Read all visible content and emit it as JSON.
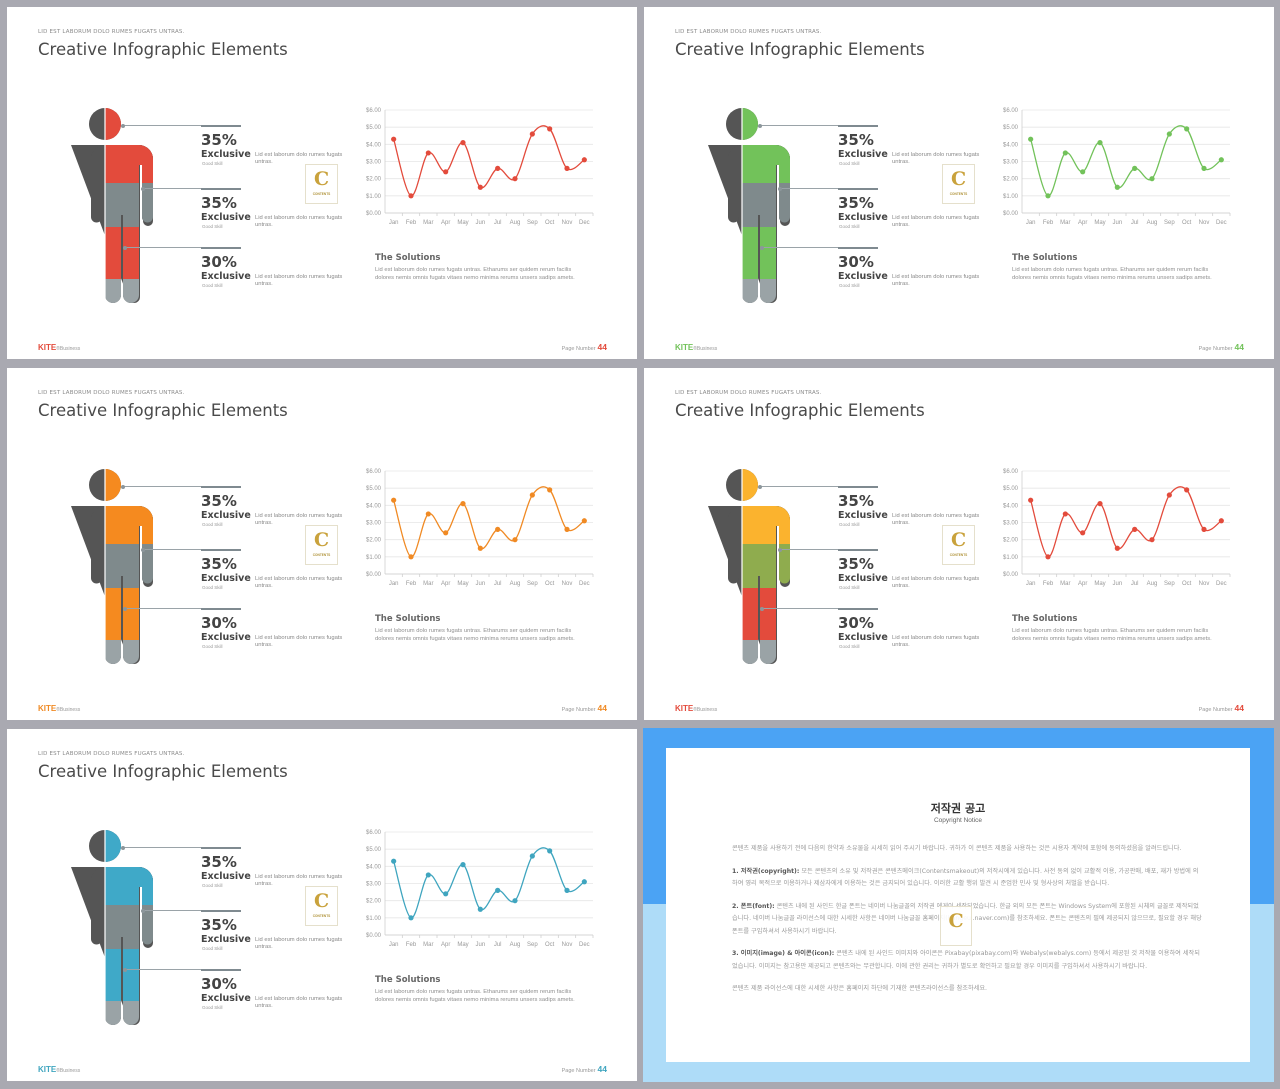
{
  "slides": [
    {
      "subtitle": "LID EST LABORUM DOLO RUMES FUGATS UNTRAS.",
      "title": "Creative Infographic Elements",
      "theme": {
        "accent": "#e34b3c",
        "upper": "#e34b3c",
        "mid": "#7f8a8c",
        "lower": "#e34b3c",
        "foot": "#9aa3a6"
      },
      "stats": [
        {
          "percent": "35%",
          "label": "Exclusive",
          "sub": "Good Skill",
          "desc": "Lid est laborum dolo rumes fugats untras."
        },
        {
          "percent": "35%",
          "label": "Exclusive",
          "sub": "Good Skill",
          "desc": "Lid est laborum dolo rumes fugats untras."
        },
        {
          "percent": "30%",
          "label": "Exclusive",
          "sub": "Good Skill",
          "desc": "Lid est laborum dolo rumes fugats untras."
        }
      ],
      "solutions_title": "The Solutions",
      "solutions_text": "Lid est laborum dolo rumes fugats untras. Etharums ser quidem rerum facilis dolores nemis omnis fugats vitaes nemo minima rerums unsers sadips amets.",
      "brand": "KITE",
      "brand_suffix": "®Business",
      "page_label": "Page Number",
      "page_number": "44"
    },
    {
      "subtitle": "LID EST LABORUM DOLO RUMES FUGATS UNTRAS.",
      "title": "Creative Infographic Elements",
      "theme": {
        "accent": "#72c25a",
        "upper": "#72c25a",
        "mid": "#7f8a8c",
        "lower": "#72c25a",
        "foot": "#9aa3a6"
      },
      "stats": [
        {
          "percent": "35%",
          "label": "Exclusive",
          "sub": "Good Skill",
          "desc": "Lid est laborum dolo rumes fugats untras."
        },
        {
          "percent": "35%",
          "label": "Exclusive",
          "sub": "Good Skill",
          "desc": "Lid est laborum dolo rumes fugats untras."
        },
        {
          "percent": "30%",
          "label": "Exclusive",
          "sub": "Good Skill",
          "desc": "Lid est laborum dolo rumes fugats untras."
        }
      ],
      "solutions_title": "The Solutions",
      "solutions_text": "Lid est laborum dolo rumes fugats untras. Etharums ser quidem rerum facilis dolores nemis omnis fugats vitaes nemo minima rerums unsers sadips amets.",
      "brand": "KITE",
      "brand_suffix": "®Business",
      "page_label": "Page Number",
      "page_number": "44"
    },
    {
      "subtitle": "LID EST LABORUM DOLO RUMES FUGATS UNTRAS.",
      "title": "Creative Infographic Elements",
      "theme": {
        "accent": "#f08a24",
        "upper": "#f58a1f",
        "mid": "#7f8a8c",
        "lower": "#f58a1f",
        "foot": "#9aa3a6"
      },
      "stats": [
        {
          "percent": "35%",
          "label": "Exclusive",
          "sub": "Good Skill",
          "desc": "Lid est laborum dolo rumes fugats untras."
        },
        {
          "percent": "35%",
          "label": "Exclusive",
          "sub": "Good Skill",
          "desc": "Lid est laborum dolo rumes fugats untras."
        },
        {
          "percent": "30%",
          "label": "Exclusive",
          "sub": "Good Skill",
          "desc": "Lid est laborum dolo rumes fugats untras."
        }
      ],
      "solutions_title": "The Solutions",
      "solutions_text": "Lid est laborum dolo rumes fugats untras. Etharums ser quidem rerum facilis dolores nemis omnis fugats vitaes nemo minima rerums unsers sadips amets.",
      "brand": "KITE",
      "brand_suffix": "®Business",
      "page_label": "Page Number",
      "page_number": "44"
    },
    {
      "subtitle": "LID EST LABORUM DOLO RUMES FUGATS UNTRAS.",
      "title": "Creative Infographic Elements",
      "theme": {
        "accent": "#e34b3c",
        "upper": "#fbb32e",
        "mid": "#8fac4e",
        "lower": "#e34b3c",
        "foot": "#9aa3a6"
      },
      "stats": [
        {
          "percent": "35%",
          "label": "Exclusive",
          "sub": "Good Skill",
          "desc": "Lid est laborum dolo rumes fugats untras."
        },
        {
          "percent": "35%",
          "label": "Exclusive",
          "sub": "Good Skill",
          "desc": "Lid est laborum dolo rumes fugats untras."
        },
        {
          "percent": "30%",
          "label": "Exclusive",
          "sub": "Good Skill",
          "desc": "Lid est laborum dolo rumes fugats untras."
        }
      ],
      "solutions_title": "The Solutions",
      "solutions_text": "Lid est laborum dolo rumes fugats untras. Etharums ser quidem rerum facilis dolores nemis omnis fugats vitaes nemo minima rerums unsers sadips amets.",
      "brand": "KITE",
      "brand_suffix": "®Business",
      "page_label": "Page Number",
      "page_number": "44"
    },
    {
      "subtitle": "LID EST LABORUM DOLO RUMES FUGATS UNTRAS.",
      "title": "Creative Infographic Elements",
      "theme": {
        "accent": "#3fa5bf",
        "upper": "#3fa9c8",
        "mid": "#7f8a8c",
        "lower": "#3fa9c8",
        "foot": "#9aa3a6"
      },
      "stats": [
        {
          "percent": "35%",
          "label": "Exclusive",
          "sub": "Good Skill",
          "desc": "Lid est laborum dolo rumes fugats untras."
        },
        {
          "percent": "35%",
          "label": "Exclusive",
          "sub": "Good Skill",
          "desc": "Lid est laborum dolo rumes fugats untras."
        },
        {
          "percent": "30%",
          "label": "Exclusive",
          "sub": "Good Skill",
          "desc": "Lid est laborum dolo rumes fugats untras."
        }
      ],
      "solutions_title": "The Solutions",
      "solutions_text": "Lid est laborum dolo rumes fugats untras. Etharums ser quidem rerum facilis dolores nemis omnis fugats vitaes nemo minima rerums unsers sadips amets.",
      "brand": "KITE",
      "brand_suffix": "®Business",
      "page_label": "Page Number",
      "page_number": "44"
    }
  ],
  "logo": {
    "letter": "C",
    "caption": "CONTENTS"
  },
  "colors": {
    "figure_dark": "#555555",
    "grid": "#e6e6e6",
    "axis": "#cfcfcf",
    "tick_text": "#999999"
  },
  "chart_data": {
    "type": "line",
    "smooth": true,
    "categories": [
      "Jan",
      "Feb",
      "Mar",
      "Apr",
      "May",
      "Jun",
      "Jul",
      "Aug",
      "Sep",
      "Oct",
      "Nov",
      "Dec"
    ],
    "values": [
      4.3,
      1.0,
      3.5,
      2.4,
      4.1,
      1.5,
      2.6,
      2.0,
      4.6,
      4.9,
      2.6,
      3.1
    ],
    "yticks": [
      "$0.00",
      "$1.00",
      "$2.00",
      "$3.00",
      "$4.00",
      "$5.00",
      "$6.00"
    ],
    "ylim": [
      0,
      6
    ],
    "title": "",
    "xlabel": "",
    "ylabel": "",
    "grid": true,
    "legend": "none"
  },
  "notice": {
    "title": "저작권 공고",
    "subtitle": "Copyright Notice",
    "intro": "콘텐츠 제품을 사용하기 전에 다음의 한약과 소유물을 시세히 읽어 주시기 바랍니다. 귀하가 이 콘텐츠 제품을 사용하는 것은 시용자 계약에 포함에 동의하셨음을 알려드립니다.",
    "p1_head": "1. 저작권(copyright):",
    "p1_body": "모든 콘텐츠의 소유 및 저작권은 콘텐츠메이크(Contentsmakeout)의 저작시에게 있습니다. 사전 동의 없이 교활적 이용, 가공판매, 배포, 재가 방법에 의하여 영리 목적으로 이용하거나 제삼자에게 이용하는 것은 금지되어 있습니다. 이러한 교활 행위 발견 시 준엄한 민사 및 형사상의 처벌을 받습니다.",
    "p2_head": "2. 폰트(font):",
    "p2_body": "콘텐츠 내에 된 사인드 한글 폰트는 네이버 나눔글꼴의 저작권 에게이 세작되었습니다. 한글 외의 모든 폰트는 Windows System에 포함된 시체의 글꼴로 제작되었습니다. 네이버 나눔글꼴 라이선스에 대한 시세한 사항은 네이버 나눔글꼴 홈페이지(hangeul.naver.com)를 참조하세요. 폰트는 콘텐츠의 필에 제공되지 않으므로, 필요할 경우 해당 폰트를 구입하셔서 사용하시기 바랍니다.",
    "p3_head": "3. 이미지(image) & 아이콘(icon):",
    "p3_body": "콘텐츠 내에 된 사인드 이미지와 아이콘은 Pixabay(pixabay.com)와 Webalys(webalys.com) 등에서 제공된 것 저작물 이용하여 세작되었습니다. 이미지는 참고용만 제공되고 콘텐츠와는 무관합니다. 이에 관한 권리는 귀하가 별도로 확인하고 필요할 경우 이미지를 구입하셔서 사용하시기 바랍니다.",
    "outro": "콘텐츠 제품 라이선스에 대한 시세한 사항은 홈페이지 하단에 기재한 콘텐츠라이선스를 참조하세요."
  }
}
